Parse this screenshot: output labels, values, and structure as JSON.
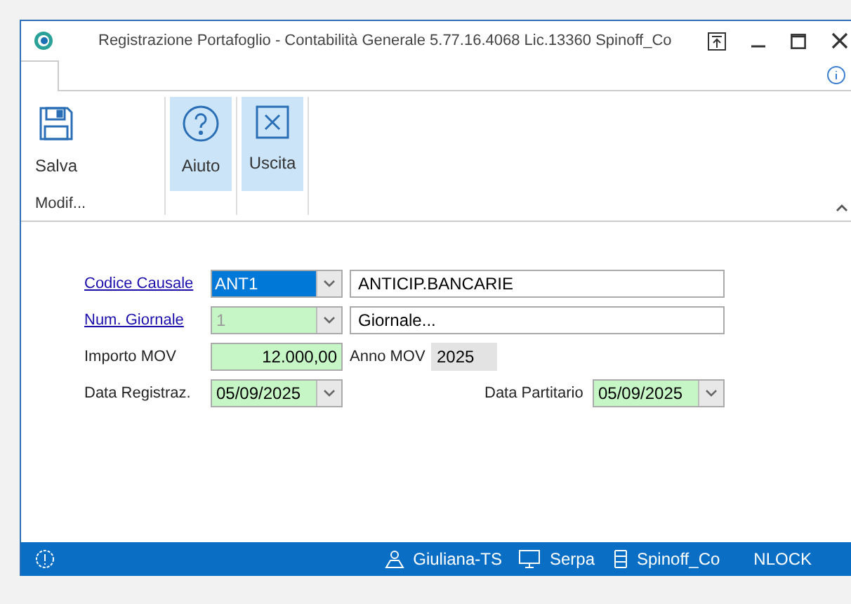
{
  "window": {
    "title": "Registrazione Portafoglio - Contabilità Generale 5.77.16.4068 Lic.13360 Spinoff_Co"
  },
  "ribbon": {
    "groups": [
      {
        "label": "Modif...",
        "buttons": [
          {
            "label": "Salva",
            "kind": "save",
            "highlighted": false
          }
        ]
      },
      {
        "buttons": [
          {
            "label": "Aiuto",
            "kind": "help",
            "highlighted": true
          }
        ]
      },
      {
        "buttons": [
          {
            "label": "Uscita",
            "kind": "exit",
            "highlighted": true
          }
        ]
      }
    ]
  },
  "form": {
    "codice_causale": {
      "label": "Codice Causale",
      "value": "ANT1",
      "focused": true,
      "description": "ANTICIP.BANCARIE"
    },
    "num_giornale": {
      "label": "Num. Giornale",
      "value": "1",
      "disabled": true,
      "description": "Giornale..."
    },
    "importo_mov": {
      "label": "Importo MOV",
      "value": "12.000,00"
    },
    "anno_mov": {
      "label": "Anno MOV",
      "value": "2025"
    },
    "data_registraz": {
      "label": "Data Registraz.",
      "value": "05/09/2025"
    },
    "data_partitario": {
      "label": "Data Partitario",
      "value": "05/09/2025"
    }
  },
  "status_bar": {
    "items": [
      {
        "kind": "user",
        "text": "Giuliana-TS"
      },
      {
        "kind": "computer",
        "text": "Serpa"
      },
      {
        "kind": "company",
        "text": "Spinoff_Co"
      },
      {
        "kind": "plain",
        "text": "NLOCK"
      }
    ]
  }
}
